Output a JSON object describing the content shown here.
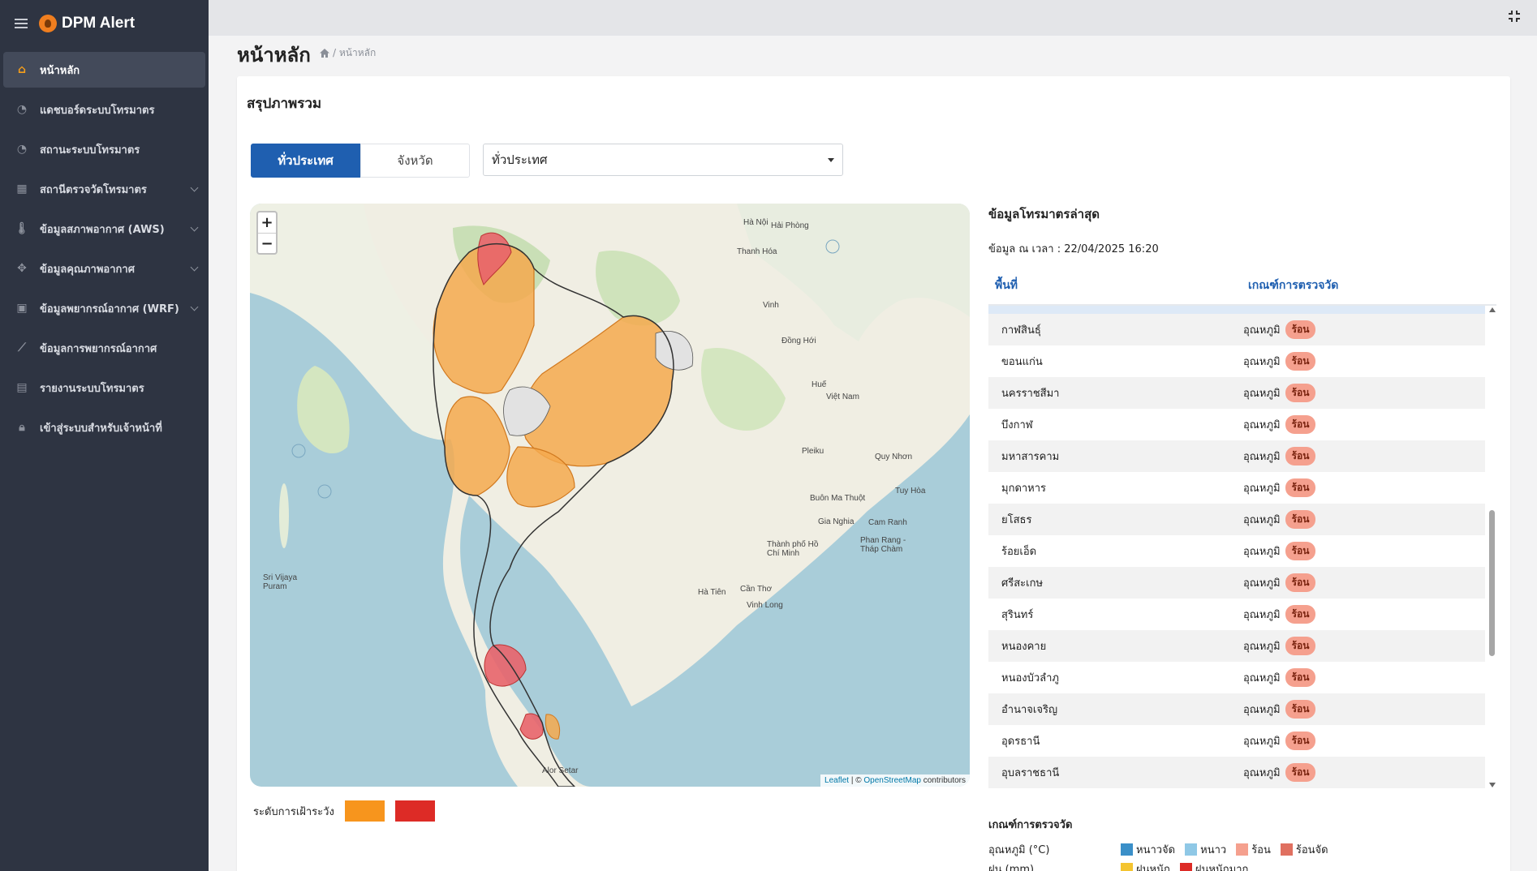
{
  "app": {
    "title": "DPM Alert"
  },
  "sidebar": {
    "items": [
      {
        "label": "หน้าหลัก",
        "icon": "home-icon",
        "active": true,
        "chevron": false
      },
      {
        "label": "แดชบอร์ดระบบโทรมาตร",
        "icon": "pie-chart-icon",
        "active": false,
        "chevron": false
      },
      {
        "label": "สถานะระบบโทรมาตร",
        "icon": "pie-chart-icon",
        "active": false,
        "chevron": false
      },
      {
        "label": "สถานีตรวจวัดโทรมาตร",
        "icon": "map-icon",
        "active": false,
        "chevron": true
      },
      {
        "label": "ข้อมูลสภาพอากาศ (AWS)",
        "icon": "thermometer-icon",
        "active": false,
        "chevron": true
      },
      {
        "label": "ข้อมูลคุณภาพอากาศ",
        "icon": "fan-icon",
        "active": false,
        "chevron": true
      },
      {
        "label": "ข้อมูลพยากรณ์อากาศ (WRF)",
        "icon": "image-icon",
        "active": false,
        "chevron": true
      },
      {
        "label": "ข้อมูลการพยากรณ์อากาศ",
        "icon": "line-chart-icon",
        "active": false,
        "chevron": false
      },
      {
        "label": "รายงานระบบโทรมาตร",
        "icon": "document-icon",
        "active": false,
        "chevron": false
      },
      {
        "label": "เข้าสู่ระบบสำหรับเจ้าหน้าที่",
        "icon": "lock-icon",
        "active": false,
        "chevron": false
      }
    ]
  },
  "page": {
    "title": "หน้าหลัก",
    "breadcrumb": "/ หน้าหลัก"
  },
  "summary": {
    "title": "สรุปภาพรวม",
    "tabs": [
      "ทั่วประเทศ",
      "จังหวัด"
    ],
    "select_value": "ทั่วประเทศ"
  },
  "map": {
    "zoom_in": "+",
    "zoom_out": "−",
    "attribution_leaflet": "Leaflet",
    "attribution_sep": " | © ",
    "attribution_osm": "OpenStreetMap",
    "attribution_tail": " contributors",
    "labels": {
      "hanoi": "Hà Nội",
      "hai_phong": "Hải Phòng",
      "thanh_hoa": "Thanh Hóa",
      "vinh": "Vinh",
      "dong_hoi": "Đồng Hới",
      "hue": "Huế",
      "viet_nam": "Việt Nam",
      "quy_nhon": "Quy Nhơn",
      "tuy_hoa": "Tuy Hòa",
      "buon_ma_thuot": "Buôn Ma Thuột",
      "cam_ranh": "Cam Ranh",
      "ho_chi_minh": "Thành phố Hồ Chí Minh",
      "can_tho": "Cần Thơ",
      "vinh_long": "Vinh Long",
      "sri_vijaya": "Sri Vijaya Puram",
      "alor_setar": "Alor Setar",
      "ha_tien": "Hà Tiên",
      "gia_nghia": "Gia Nghia",
      "pleiku": "Pleiku",
      "phan_rang": "Phan Rang - Tháp Chàm"
    }
  },
  "legend": {
    "label": "ระดับการเฝ้าระวัง",
    "colors": [
      "#f7951d",
      "#dd2b26"
    ]
  },
  "panel": {
    "title": "ข้อมูลโทรมาตรล่าสุด",
    "time_text": "ข้อมูล ณ เวลา : 22/04/2025 16:20",
    "columns": [
      "พื้นที่",
      "เกณฑ์การตรวจวัด"
    ],
    "rows": [
      {
        "area": "กาฬสินธุ์",
        "metric": "อุณหภูมิ",
        "level": "ร้อน"
      },
      {
        "area": "ขอนแก่น",
        "metric": "อุณหภูมิ",
        "level": "ร้อน"
      },
      {
        "area": "นครราชสีมา",
        "metric": "อุณหภูมิ",
        "level": "ร้อน"
      },
      {
        "area": "บึงกาฬ",
        "metric": "อุณหภูมิ",
        "level": "ร้อน"
      },
      {
        "area": "มหาสารคาม",
        "metric": "อุณหภูมิ",
        "level": "ร้อน"
      },
      {
        "area": "มุกดาหาร",
        "metric": "อุณหภูมิ",
        "level": "ร้อน"
      },
      {
        "area": "ยโสธร",
        "metric": "อุณหภูมิ",
        "level": "ร้อน"
      },
      {
        "area": "ร้อยเอ็ด",
        "metric": "อุณหภูมิ",
        "level": "ร้อน"
      },
      {
        "area": "ศรีสะเกษ",
        "metric": "อุณหภูมิ",
        "level": "ร้อน"
      },
      {
        "area": "สุรินทร์",
        "metric": "อุณหภูมิ",
        "level": "ร้อน"
      },
      {
        "area": "หนองคาย",
        "metric": "อุณหภูมิ",
        "level": "ร้อน"
      },
      {
        "area": "หนองบัวลำภู",
        "metric": "อุณหภูมิ",
        "level": "ร้อน"
      },
      {
        "area": "อำนาจเจริญ",
        "metric": "อุณหภูมิ",
        "level": "ร้อน"
      },
      {
        "area": "อุดรธานี",
        "metric": "อุณหภูมิ",
        "level": "ร้อน"
      },
      {
        "area": "อุบลราชธานี",
        "metric": "อุณหภูมิ",
        "level": "ร้อน"
      }
    ]
  },
  "criteria": {
    "title": "เกณฑ์การตรวจวัด",
    "temperature": {
      "label": "อุณหภูมิ (°C)",
      "items": [
        {
          "name": "หนาวจัด",
          "color": "#3a8fc8"
        },
        {
          "name": "หนาว",
          "color": "#8fc8e6"
        },
        {
          "name": "ร้อน",
          "color": "#f5a08e"
        },
        {
          "name": "ร้อนจัด",
          "color": "#e07060"
        }
      ]
    },
    "rain": {
      "label": "ฝน (mm)",
      "items": [
        {
          "name": "ฝนหนัก",
          "color": "#f4c430"
        },
        {
          "name": "ฝนหนักมาก",
          "color": "#dd2b26"
        }
      ]
    }
  }
}
